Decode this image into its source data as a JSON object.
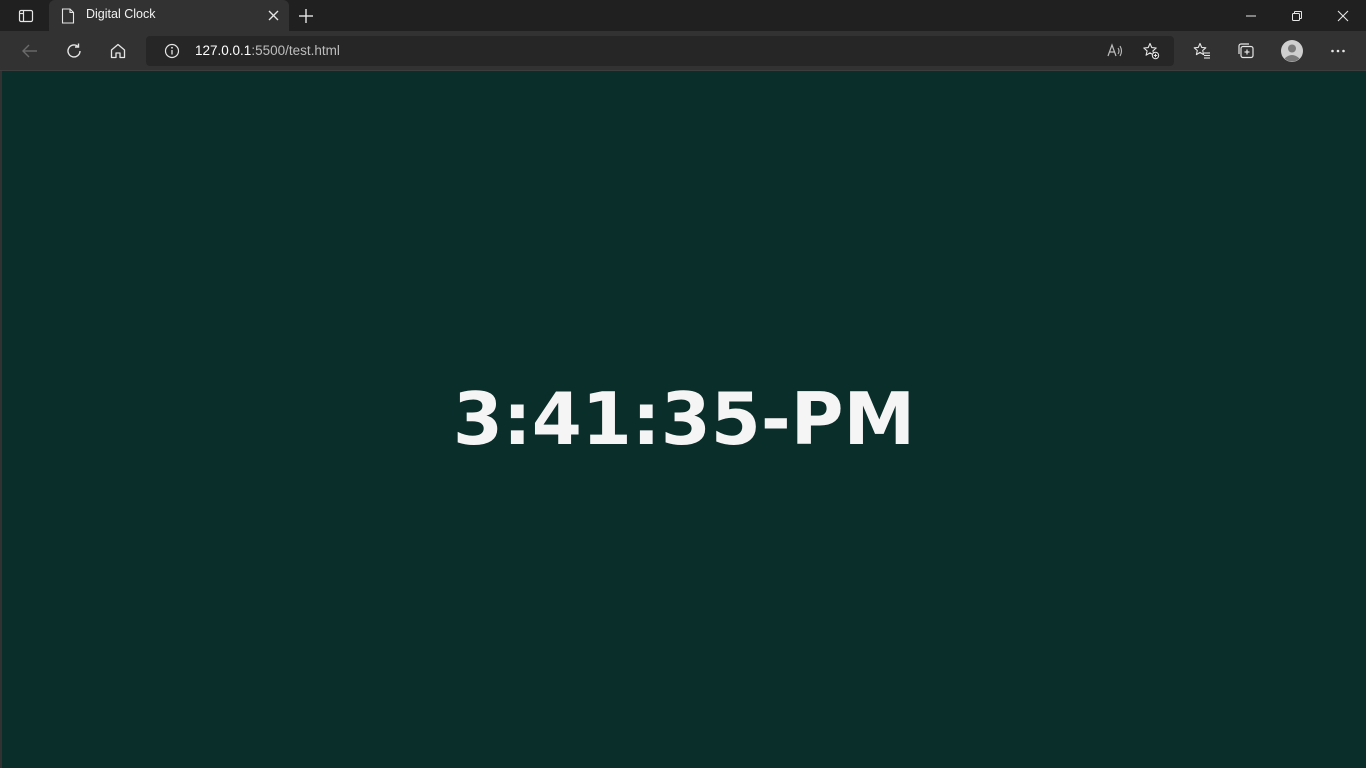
{
  "browser": {
    "tab": {
      "title": "Digital Clock"
    },
    "address": {
      "host": "127.0.0.1",
      "rest": ":5500/test.html"
    }
  },
  "page": {
    "clock_text": "3:41:35-PM"
  },
  "colors": {
    "page_background": "#0a2e2a",
    "clock_text": "#f5f5f5",
    "browser_chrome": "#323232"
  }
}
